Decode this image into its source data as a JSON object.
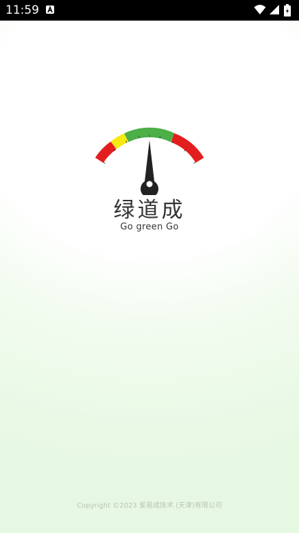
{
  "status_bar": {
    "time": "11:59",
    "icons": [
      "notification-a-icon",
      "wifi-icon",
      "signal-icon",
      "battery-icon"
    ]
  },
  "splash": {
    "logo_icon": "speedometer-gauge-icon",
    "title": "绿道成",
    "slogan": "Go green Go"
  },
  "footer": {
    "copyright": "Copyright ©2023 爱易成技术 (天津)有限公司"
  },
  "colors": {
    "gauge_red": "#e31e1e",
    "gauge_yellow": "#f6ea10",
    "gauge_green": "#4caf48",
    "needle": "#222222",
    "background_tint": "#e6f8e2",
    "text": "#333333"
  }
}
